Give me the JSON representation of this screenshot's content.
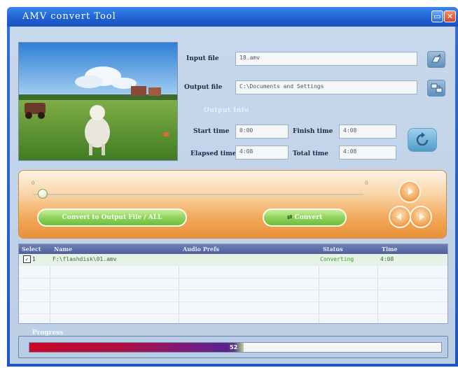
{
  "window": {
    "title": "AMV convert Tool"
  },
  "titlebar": {
    "minimize_glyph": "▭",
    "close_glyph": "✕"
  },
  "fields": {
    "input_label": "Input file",
    "input_value": "18.amv",
    "output_label": "Output file",
    "output_value": "C:\\Documents and Settings",
    "group_label": "Output Info",
    "start_label": "Start time",
    "start_value": "0:00",
    "finish_label": "Finish time",
    "finish_value": "4:08",
    "elapsed_label": "Elapsed time",
    "elapsed_value": "4:08",
    "total_label": "Total time",
    "total_value": "4:08"
  },
  "controls": {
    "slider_start": "0",
    "slider_end": "0",
    "slider_position": 0.02,
    "left_pill_label": "Convert to Output File / ALL",
    "right_pill_label": "Convert",
    "dial_top_icon": "play-icon",
    "dial_left_icon": "prev-icon",
    "dial_right_icon": "next-icon"
  },
  "list": {
    "columns": [
      "Select",
      "Name",
      "Audio Prefs",
      "Status",
      "Time"
    ],
    "rows": [
      {
        "select": "1",
        "name": "F:\\flashdisk\\01.amv",
        "audio": "",
        "status": "Converting",
        "time": "4:08"
      }
    ]
  },
  "progress": {
    "label": "Progress",
    "fraction": 0.52,
    "percent_text": "52"
  },
  "colors": {
    "titlebar": "#1f5fd0",
    "status_text": "#3aa02a",
    "band": "#f2a85a"
  }
}
